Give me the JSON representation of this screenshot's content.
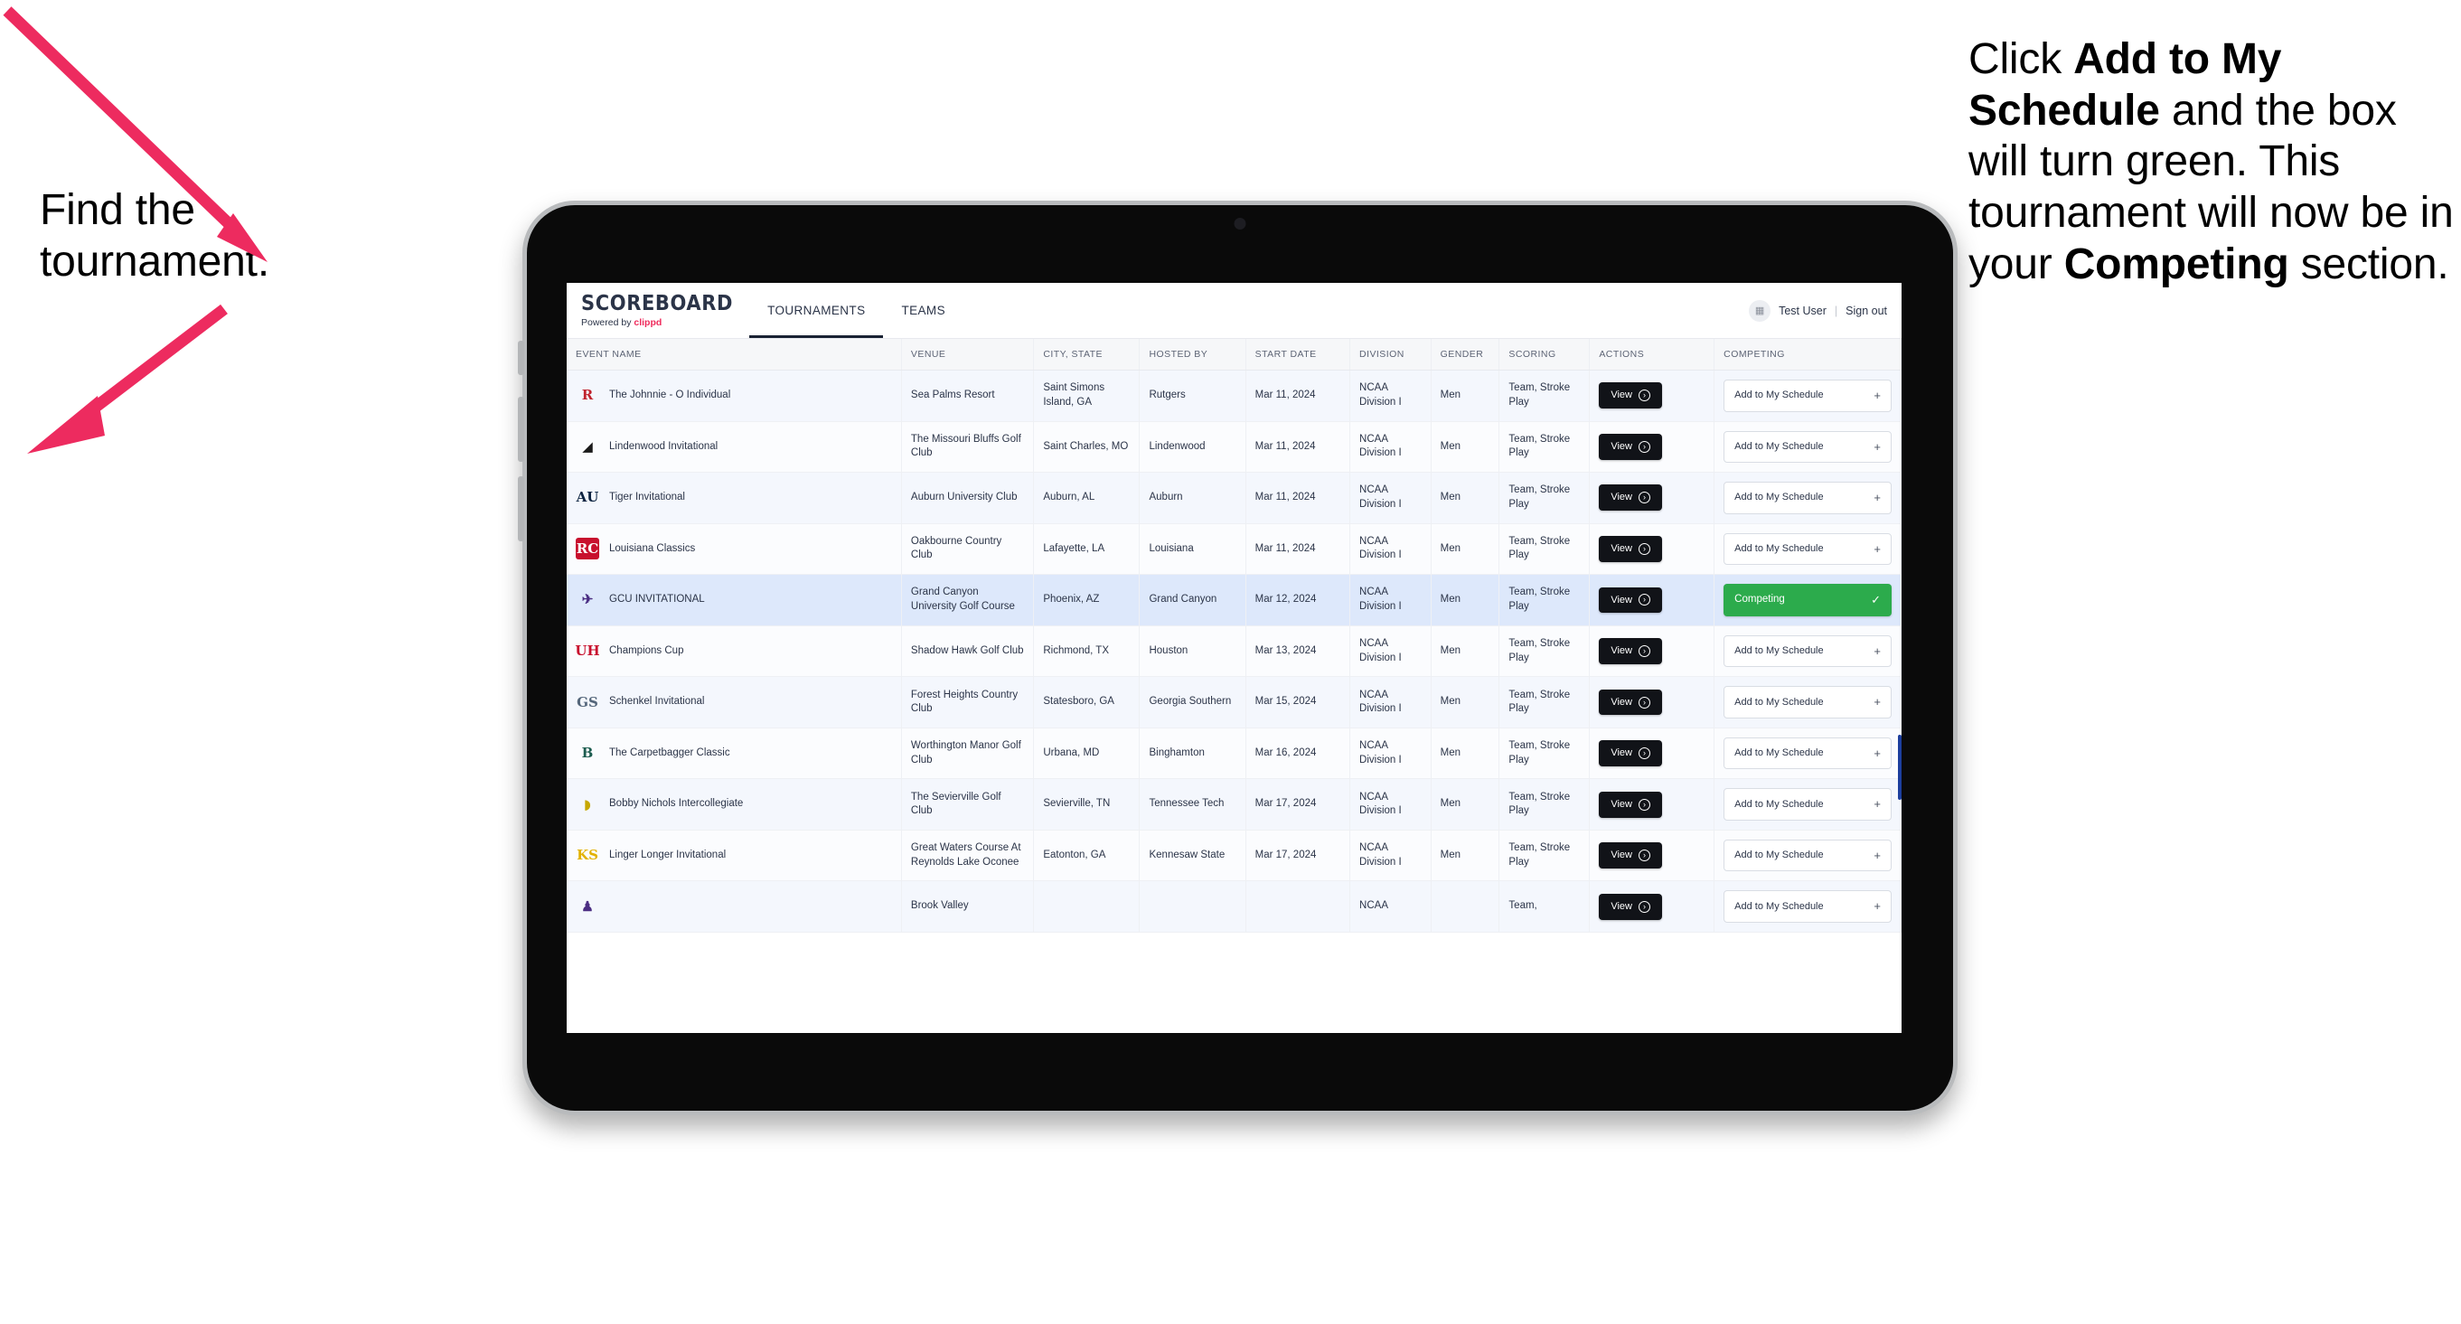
{
  "annotations": {
    "left": {
      "line1": "Find the",
      "line2": "tournament."
    },
    "right": {
      "p1_a": "Click ",
      "p1_b": "Add to My Schedule",
      "p1_c": " and the box will turn green. This tournament will now be in your ",
      "p1_d": "Competing",
      "p1_e": " section."
    }
  },
  "arrow_color": "#ed2b5f",
  "app": {
    "brand": {
      "title": "SCOREBOARD",
      "powered_prefix": "Powered by ",
      "powered_brand": "clippd"
    },
    "tabs": [
      {
        "label": "TOURNAMENTS",
        "active": true
      },
      {
        "label": "TEAMS",
        "active": false
      }
    ],
    "header_right": {
      "avatar_icon": "grid-icon",
      "user": "Test User",
      "separator": "|",
      "signout": "Sign out"
    },
    "table": {
      "columns": [
        "EVENT NAME",
        "VENUE",
        "CITY, STATE",
        "HOSTED BY",
        "START DATE",
        "DIVISION",
        "GENDER",
        "SCORING",
        "ACTIONS",
        "COMPETING"
      ],
      "view_label": "View",
      "add_label": "Add to My Schedule",
      "add_plus": "+",
      "competing_label": "Competing",
      "competing_check": "✓",
      "rows": [
        {
          "logo": {
            "text": "R",
            "color": "#c0232d",
            "bg": "transparent"
          },
          "event": "The Johnnie - O Individual",
          "venue": "Sea Palms Resort",
          "city": "Saint Simons Island, GA",
          "host": "Rutgers",
          "date": "Mar 11, 2024",
          "division": "NCAA Division I",
          "gender": "Men",
          "scoring": "Team, Stroke Play",
          "competing": false
        },
        {
          "logo": {
            "text": "◢",
            "color": "#1a1a1a",
            "bg": "transparent"
          },
          "event": "Lindenwood Invitational",
          "venue": "The Missouri Bluffs Golf Club",
          "city": "Saint Charles, MO",
          "host": "Lindenwood",
          "date": "Mar 11, 2024",
          "division": "NCAA Division I",
          "gender": "Men",
          "scoring": "Team, Stroke Play",
          "competing": false
        },
        {
          "logo": {
            "text": "AU",
            "color": "#0c2340",
            "bg": "transparent"
          },
          "event": "Tiger Invitational",
          "venue": "Auburn University Club",
          "city": "Auburn, AL",
          "host": "Auburn",
          "date": "Mar 11, 2024",
          "division": "NCAA Division I",
          "gender": "Men",
          "scoring": "Team, Stroke Play",
          "competing": false
        },
        {
          "logo": {
            "text": "RC",
            "color": "#ffffff",
            "bg": "#c8102e"
          },
          "event": "Louisiana Classics",
          "venue": "Oakbourne Country Club",
          "city": "Lafayette, LA",
          "host": "Louisiana",
          "date": "Mar 11, 2024",
          "division": "NCAA Division I",
          "gender": "Men",
          "scoring": "Team, Stroke Play",
          "competing": false
        },
        {
          "logo": {
            "text": "✈",
            "color": "#4b2e83",
            "bg": "transparent"
          },
          "event": "GCU INVITATIONAL",
          "venue": "Grand Canyon University Golf Course",
          "city": "Phoenix, AZ",
          "host": "Grand Canyon",
          "date": "Mar 12, 2024",
          "division": "NCAA Division I",
          "gender": "Men",
          "scoring": "Team, Stroke Play",
          "competing": true
        },
        {
          "logo": {
            "text": "UH",
            "color": "#c8102e",
            "bg": "transparent"
          },
          "event": "Champions Cup",
          "venue": "Shadow Hawk Golf Club",
          "city": "Richmond, TX",
          "host": "Houston",
          "date": "Mar 13, 2024",
          "division": "NCAA Division I",
          "gender": "Men",
          "scoring": "Team, Stroke Play",
          "competing": false
        },
        {
          "logo": {
            "text": "GS",
            "color": "#54667a",
            "bg": "transparent"
          },
          "event": "Schenkel Invitational",
          "venue": "Forest Heights Country Club",
          "city": "Statesboro, GA",
          "host": "Georgia Southern",
          "date": "Mar 15, 2024",
          "division": "NCAA Division I",
          "gender": "Men",
          "scoring": "Team, Stroke Play",
          "competing": false
        },
        {
          "logo": {
            "text": "B",
            "color": "#1c5c4f",
            "bg": "transparent"
          },
          "event": "The Carpetbagger Classic",
          "venue": "Worthington Manor Golf Club",
          "city": "Urbana, MD",
          "host": "Binghamton",
          "date": "Mar 16, 2024",
          "division": "NCAA Division I",
          "gender": "Men",
          "scoring": "Team, Stroke Play",
          "competing": false
        },
        {
          "logo": {
            "text": "◗",
            "color": "#c6a700",
            "bg": "transparent"
          },
          "event": "Bobby Nichols Intercollegiate",
          "venue": "The Sevierville Golf Club",
          "city": "Sevierville, TN",
          "host": "Tennessee Tech",
          "date": "Mar 17, 2024",
          "division": "NCAA Division I",
          "gender": "Men",
          "scoring": "Team, Stroke Play",
          "competing": false
        },
        {
          "logo": {
            "text": "KS",
            "color": "#e2b100",
            "bg": "transparent"
          },
          "event": "Linger Longer Invitational",
          "venue": "Great Waters Course At Reynolds Lake Oconee",
          "city": "Eatonton, GA",
          "host": "Kennesaw State",
          "date": "Mar 17, 2024",
          "division": "NCAA Division I",
          "gender": "Men",
          "scoring": "Team, Stroke Play",
          "competing": false
        },
        {
          "logo": {
            "text": "♟",
            "color": "#4b2e83",
            "bg": "transparent"
          },
          "event": "",
          "venue": "Brook Valley",
          "city": "",
          "host": "",
          "date": "",
          "division": "NCAA",
          "gender": "",
          "scoring": "Team,",
          "competing": false,
          "clipped": true
        }
      ]
    }
  }
}
